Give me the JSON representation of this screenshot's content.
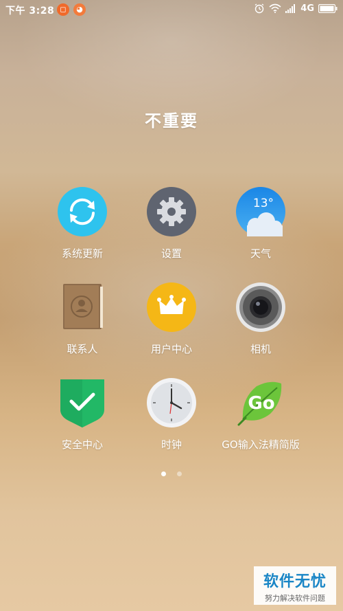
{
  "status_bar": {
    "time": "下午 3:28",
    "notification_icons": [
      "notification-icon",
      "weibo-icon"
    ],
    "network": "4G",
    "icons": [
      "alarm-icon",
      "wifi-icon",
      "signal-icon",
      "battery-icon"
    ]
  },
  "folder": {
    "title": "不重要",
    "apps": [
      {
        "label": "系统更新",
        "icon": "system-update-icon",
        "color": "#2ec3ee"
      },
      {
        "label": "设置",
        "icon": "settings-gear-icon",
        "color": "#5f6470"
      },
      {
        "label": "天气",
        "icon": "weather-icon",
        "temperature": "13°",
        "color": "#1e8fe8"
      },
      {
        "label": "联系人",
        "icon": "contacts-book-icon",
        "color": "#9b7a58"
      },
      {
        "label": "用户中心",
        "icon": "crown-icon",
        "color": "#f5b716"
      },
      {
        "label": "相机",
        "icon": "camera-lens-icon",
        "color": "#5a5a5a"
      },
      {
        "label": "安全中心",
        "icon": "shield-check-icon",
        "color": "#22b866"
      },
      {
        "label": "时钟",
        "icon": "clock-icon",
        "color": "#e9ebee"
      },
      {
        "label": "GO输入法精简版",
        "icon": "go-keyboard-icon",
        "color": "#6cc53b"
      }
    ]
  },
  "pager": {
    "pages": 2,
    "active_page": 1
  },
  "watermark": {
    "title": "软件无忧",
    "subtitle": "努力解决软件问题"
  }
}
